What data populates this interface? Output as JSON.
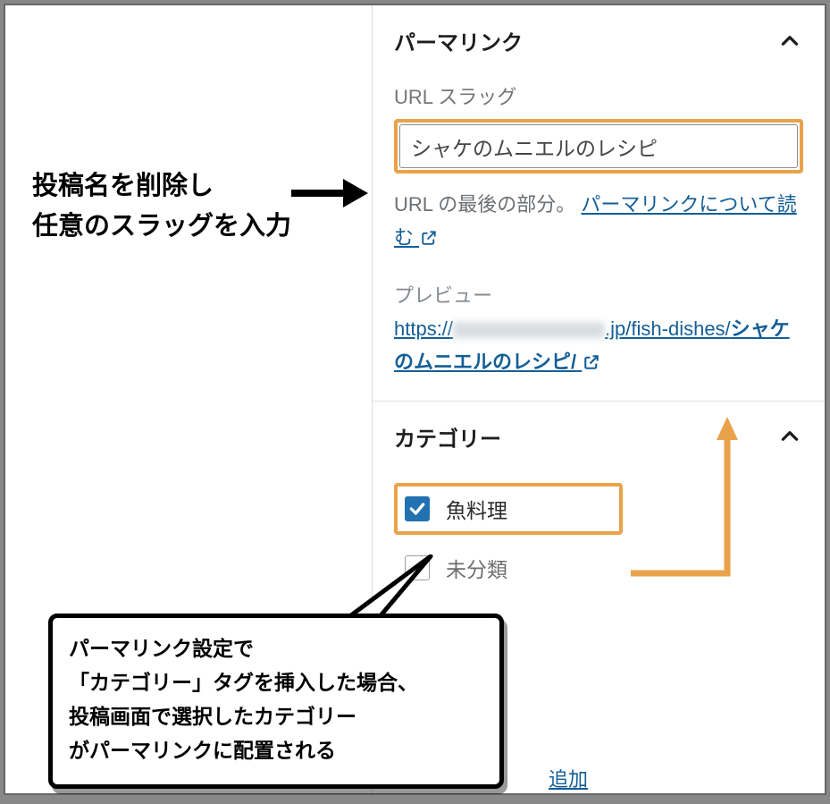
{
  "annotations": {
    "top_left_line1": "投稿名を削除し",
    "top_left_line2": "任意のスラッグを入力",
    "bubble_line1": "パーマリンク設定で",
    "bubble_line2": "「カテゴリー」タグを挿入した場合、",
    "bubble_line3": "投稿画面で選択したカテゴリー",
    "bubble_line4": "がパーマリンクに配置される"
  },
  "permalink_panel": {
    "title": "パーマリンク",
    "slug_label": "URL スラッグ",
    "slug_value": "シャケのムニエルのレシピ",
    "help_prefix": "URL の最後の部分。 ",
    "help_link": "パーマリンクについて読む",
    "preview_label": "プレビュー",
    "preview_url_prefix": "https://",
    "preview_url_suffix": ".jp/fish-dishes/",
    "preview_url_slug": "シャケのムニエルのレシピ/"
  },
  "categories_panel": {
    "title": "カテゴリー",
    "items": [
      {
        "label": "魚料理",
        "checked": true
      },
      {
        "label": "未分類",
        "checked": false
      }
    ],
    "add_link_visible": "追加"
  }
}
